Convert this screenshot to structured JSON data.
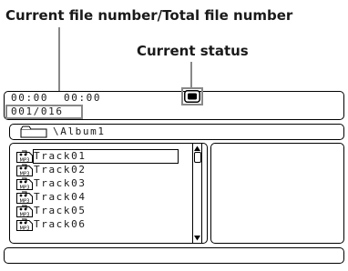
{
  "callouts": {
    "file_number": "Current file number/Total file number",
    "status": "Current status"
  },
  "status_panel": {
    "time_elapsed": "00:00",
    "time_total": "00:00",
    "file_counter": "001/016",
    "status_icon": "stop-icon"
  },
  "folder_bar": {
    "icon": "folder-icon",
    "path": "\\Album1"
  },
  "file_list": {
    "selected_index": 0,
    "file_type_icon": "mp3-file-icon",
    "file_type_label": "MP3",
    "items": [
      "Track01",
      "Track02",
      "Track03",
      "Track04",
      "Track05",
      "Track06"
    ]
  },
  "colors": {
    "callout_gray": "#888888",
    "outline": "#000000"
  }
}
